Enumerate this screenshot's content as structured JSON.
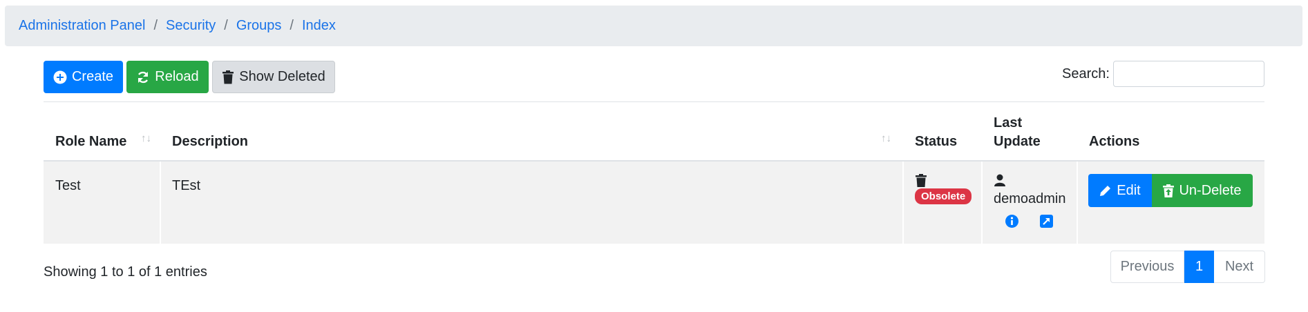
{
  "breadcrumb": {
    "items": [
      "Administration Panel",
      "Security",
      "Groups",
      "Index"
    ],
    "separator": "/"
  },
  "toolbar": {
    "create_label": "Create",
    "reload_label": "Reload",
    "show_deleted_label": "Show Deleted"
  },
  "search": {
    "label": "Search:",
    "value": ""
  },
  "table": {
    "columns": [
      "Role Name",
      "Description",
      "Status",
      "Last Update",
      "Actions"
    ],
    "last_update_line1": "Last",
    "last_update_line2": "Update",
    "rows": [
      {
        "role_name": "Test",
        "description": "TEst",
        "status_badge": "Obsolete",
        "last_update_user": "demoadmin",
        "edit_label": "Edit",
        "undelete_label": "Un-Delete"
      }
    ]
  },
  "footer": {
    "info": "Showing 1 to 1 of 1 entries",
    "pagination": {
      "previous": "Previous",
      "current": "1",
      "next": "Next"
    }
  },
  "colors": {
    "primary": "#007bff",
    "success": "#28a745",
    "danger": "#dc3545",
    "breadcrumb_bg": "#e9ecef"
  }
}
